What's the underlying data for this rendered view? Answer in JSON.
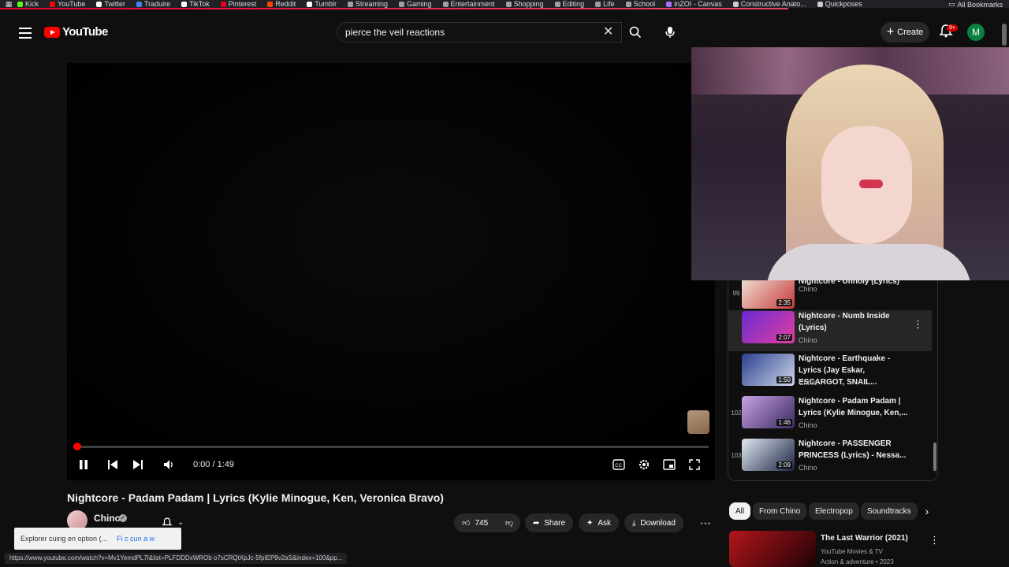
{
  "bookmarks": {
    "items": [
      {
        "label": "Kick",
        "color": "#53fc18"
      },
      {
        "label": "YouTube",
        "color": "#ff0000"
      },
      {
        "label": "Twitter",
        "color": "#ffffff"
      },
      {
        "label": "Traduire",
        "color": "#4285f4"
      },
      {
        "label": "TikTok",
        "color": "#ffffff"
      },
      {
        "label": "Pinterest",
        "color": "#e60023"
      },
      {
        "label": "Reddit",
        "color": "#ff4500"
      },
      {
        "label": "Tumblr",
        "color": "#ffffff"
      },
      {
        "label": "Streaming",
        "color": "#9aa0a6"
      },
      {
        "label": "Gaming",
        "color": "#9aa0a6"
      },
      {
        "label": "Entertainment",
        "color": "#9aa0a6"
      },
      {
        "label": "Shopping",
        "color": "#9aa0a6"
      },
      {
        "label": "Editing",
        "color": "#9aa0a6"
      },
      {
        "label": "Life",
        "color": "#9aa0a6"
      },
      {
        "label": "School",
        "color": "#9aa0a6"
      },
      {
        "label": "inZOI - Canvas",
        "color": "#a970ff"
      },
      {
        "label": "Constructive Anato...",
        "color": "#cccccc"
      },
      {
        "label": "Quickposes",
        "color": "#cccccc"
      }
    ],
    "all_label": "All Bookmarks"
  },
  "header": {
    "logo_text": "YouTube",
    "search_value": "pierce the veil reactions",
    "create_label": "Create",
    "notif_badge": "9+",
    "avatar_letter": "M"
  },
  "player": {
    "time_display": "0:00 / 1:49",
    "progress": 0.0
  },
  "video": {
    "title": "Nightcore - Padam Padam | Lyrics (Kylie Minogue, Ken, Veronica Bravo)",
    "channel": "Chino",
    "verified_mark": "✓",
    "like_count": "745",
    "share_label": "Share",
    "ask_label": "Ask",
    "download_label": "Download"
  },
  "playlist": {
    "items": [
      {
        "index": "99",
        "title": "Nightcore - Unholy (Lyrics)",
        "channel": "Chino",
        "duration": "2:35",
        "colors": [
          "#f1e4d8",
          "#c63a3a"
        ]
      },
      {
        "index": "",
        "title": "Nightcore - Numb Inside (Lyrics)",
        "channel": "Chino",
        "duration": "2:07",
        "colors": [
          "#6a2bd1",
          "#e23fa0"
        ],
        "active": true
      },
      {
        "index": "",
        "title": "Nightcore - Earthquake - Lyrics (Jay Eskar, ESCARGOT, SNAIL...",
        "channel": "Chino",
        "duration": "1:50",
        "colors": [
          "#2a3f8f",
          "#cfd7e8"
        ]
      },
      {
        "index": "102",
        "title": "Nightcore - Padam Padam | Lyrics (Kylie Minogue, Ken,...",
        "channel": "Chino",
        "duration": "1:46",
        "colors": [
          "#c7a1e6",
          "#3b2a5e"
        ]
      },
      {
        "index": "103",
        "title": "Nightcore - PASSENGER PRINCESS (Lyrics) - Nessa...",
        "channel": "Chino",
        "duration": "2:09",
        "colors": [
          "#dfe8f2",
          "#1c2440"
        ]
      }
    ]
  },
  "chips": [
    "All",
    "From Chino",
    "Electropop",
    "Soundtracks"
  ],
  "recommendation": {
    "title": "The Last Warrior (2021)",
    "channel": "YouTube Movies & TV",
    "meta": "Action & adventure • 2023"
  },
  "toast": {
    "text": "Explorer cuing en option (...",
    "action": "Fi c cun a w"
  },
  "status_url": "https://www.youtube.com/watch?v=Mv1YemdPL7I&list=PLFDDDxWROb o7sCRQtXpJc-5fpIEP9v2aS&index=100&pp..."
}
